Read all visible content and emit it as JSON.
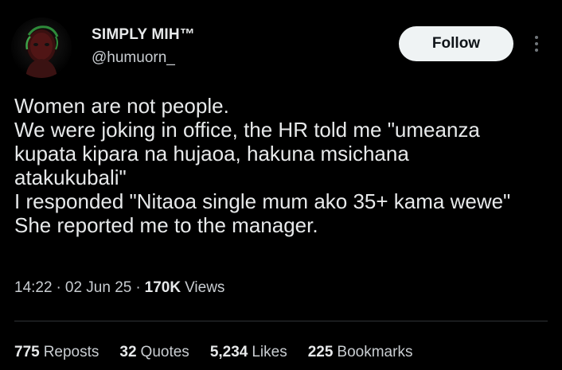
{
  "author": {
    "display_name": "SIMPLY MIH™",
    "handle": "@humuorn_",
    "avatar_icon": "profile-avatar-icon"
  },
  "actions": {
    "follow_label": "Follow",
    "more_icon": "more-vertical-icon"
  },
  "tweet": {
    "lines": [
      "Women are not people.",
      "We were joking in office, the HR told me \"umeanza",
      "kupata kipara na hujaoa, hakuna msichana",
      "atakukubali\"",
      "I responded \"Nitaoa single mum ako 35+ kama wewe\"",
      "She reported me to the manager."
    ]
  },
  "meta": {
    "time": "14:22",
    "separator": "·",
    "date": "02 Jun 25",
    "views_count": "170K",
    "views_label": "Views"
  },
  "stats": {
    "reposts_count": "775",
    "reposts_label": "Reposts",
    "quotes_count": "32",
    "quotes_label": "Quotes",
    "likes_count": "5,234",
    "likes_label": "Likes",
    "bookmarks_count": "225",
    "bookmarks_label": "Bookmarks"
  },
  "colors": {
    "background": "#000000",
    "text_primary": "#e7e9ea",
    "text_secondary": "#c9cdd1",
    "follow_button_bg": "#eff3f4",
    "follow_button_text": "#0f1419",
    "divider": "#2f3336"
  }
}
